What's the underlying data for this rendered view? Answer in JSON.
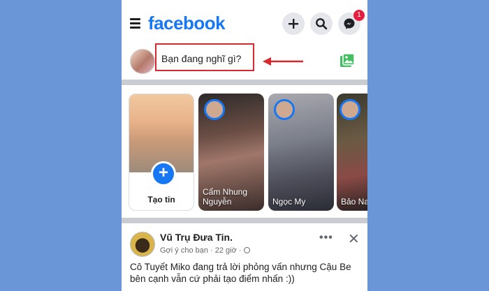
{
  "header": {
    "logo": "facebook",
    "messenger_badge": "1",
    "icons": [
      "menu-icon",
      "plus-icon",
      "search-icon",
      "messenger-icon"
    ]
  },
  "composer": {
    "placeholder": "Bạn đang nghĩ gì?"
  },
  "stories": {
    "create_label": "Tạo tin",
    "items": [
      {
        "name": "Cẩm Nhung Nguyễn"
      },
      {
        "name": "Ngọc My"
      },
      {
        "name": "Bảo Na"
      }
    ]
  },
  "post": {
    "author": "Vũ Trụ Đưa Tin.",
    "meta": "Gợi ý cho bạn · 22 giờ ·",
    "more": "•••",
    "close": "✕",
    "text": "Cô Tuyết Miko đang trả lời phỏng vấn nhưng Cậu Be bên cạnh vẫn cứ phải tạo điểm nhấn :))"
  },
  "colors": {
    "brand": "#1877f2",
    "highlight": "#d7282d",
    "background": "#6a95d6"
  }
}
